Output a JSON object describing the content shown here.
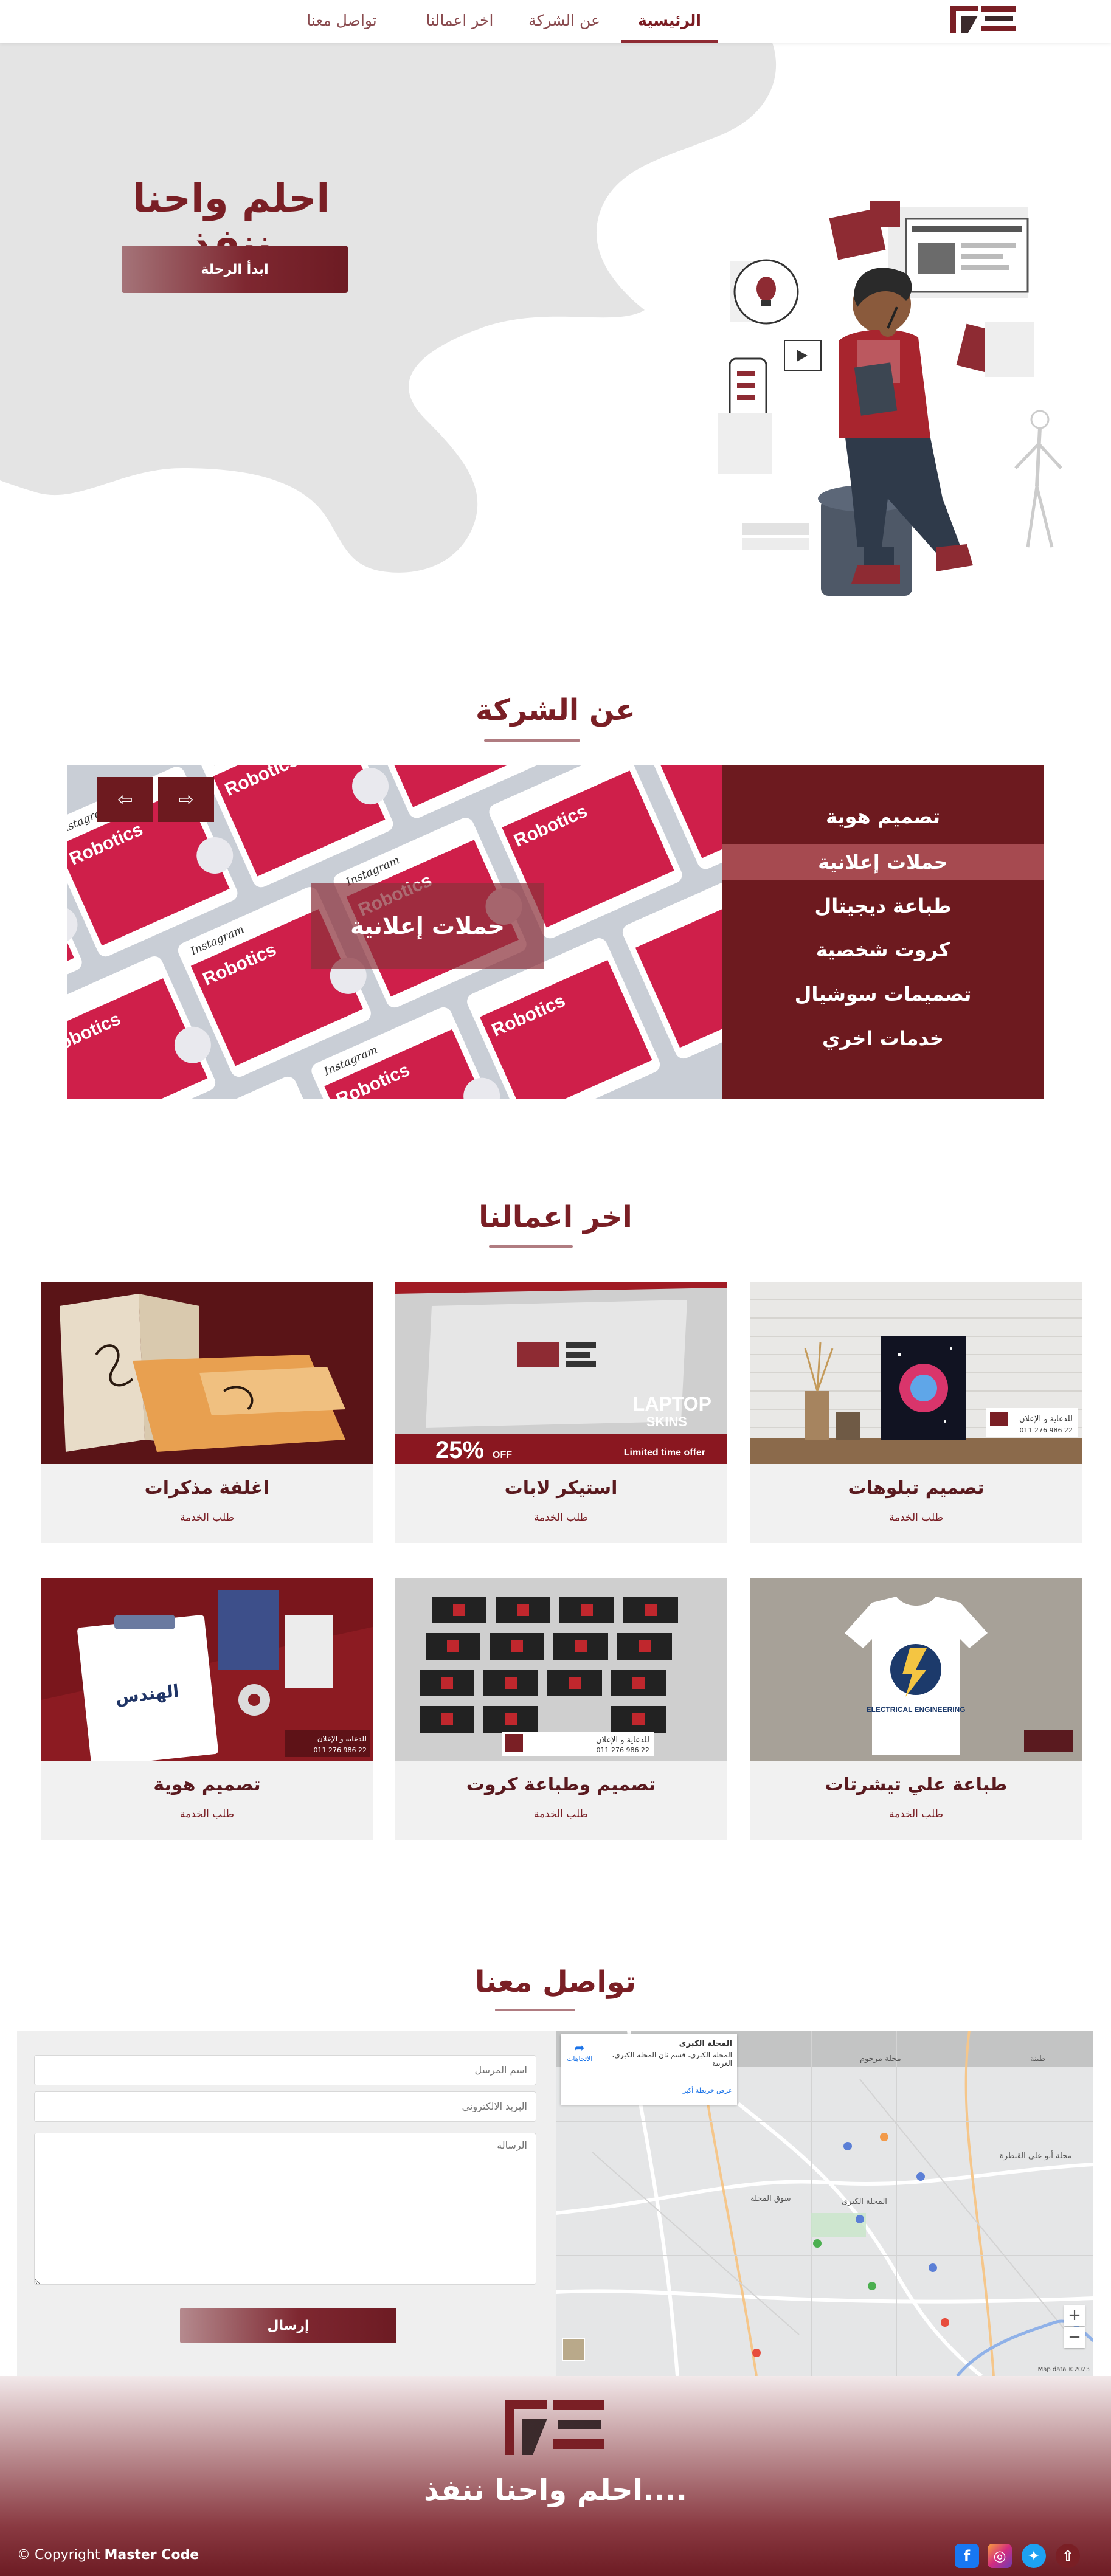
{
  "nav": {
    "links": [
      "الرئيسية",
      "عن الشركة",
      "اخر اعمالنا",
      "تواصل معنا"
    ],
    "active": "الرئيسية"
  },
  "hero": {
    "title": "احلم واحنا ننفذ",
    "button": "ابدأ الرحلة"
  },
  "about": {
    "title": "عن الشركة",
    "services": [
      "تصميم هوية",
      "حملات إعلانية",
      "طباعة ديجيتال",
      "كروت شخصية",
      "تصميمات سوشيال",
      "خدمات اخري"
    ],
    "active_service": "حملات إعلانية",
    "slide_caption": "حملات إعلانية",
    "slide_texts": [
      "Robotics",
      "Instagram"
    ]
  },
  "works": {
    "title": "اخر اعمالنا",
    "cta": "طلب الخدمة",
    "items": [
      {
        "title": "تصميم تبلوهات",
        "image": "canvas-painting-mockup"
      },
      {
        "title": "استيكر لابات",
        "image": "laptop-skins-promo"
      },
      {
        "title": "اغلفة مذكرات",
        "image": "notebook-covers-mockup"
      },
      {
        "title": "طباعة علي تيشرتات",
        "image": "tshirt-print-mockup"
      },
      {
        "title": "تصميم وطباعة كروت",
        "image": "business-cards-mockup"
      },
      {
        "title": "تصميم هوية",
        "image": "brand-identity-mockup"
      }
    ],
    "image_texts": {
      "laptop_line1": "LAPTOP",
      "laptop_line2": "SKINS",
      "discount": "25%",
      "discount_off": "OFF",
      "limited": "Limited time offer",
      "brand_line1": "للدعاية و الإعلان",
      "brand_line2": "011 276 986 22",
      "tshirt_text": "ELECTRICAL ENGINEERING"
    }
  },
  "contact": {
    "title": "تواصل معنا",
    "name_placeholder": "اسم المرسل",
    "email_placeholder": "البريد الالكتروني",
    "message_placeholder": "الرسالة",
    "send": "إرسال",
    "map": {
      "place_name": "المحلة الكبرى",
      "place_address": "المحلة الكبرى، قسم ثان المحلة الكبرى، الغربية",
      "directions": "الاتجاهات",
      "larger_map": "عرض خريطة أكبر",
      "footer_note": "Map data ©2023",
      "labels": [
        "المحلة الكبرى",
        "محلة أبو علي القنطرة",
        "سوق المحلة",
        "طبنة",
        "محلة مرحوم"
      ]
    }
  },
  "footer": {
    "tagline": "احلم واحنا ننفذ....",
    "copyright_prefix": "© Copyright",
    "copyright_brand": "Master Code"
  },
  "colors": {
    "primary": "#7a1f25",
    "menu_bg": "#6d1a1f",
    "menu_active": "#a64a50",
    "hero_blob": "#e4e4e4"
  }
}
